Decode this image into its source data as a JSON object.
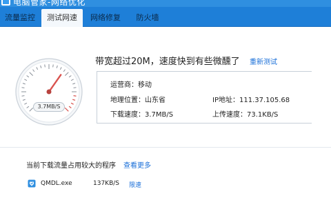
{
  "window": {
    "title": "电脑管家-网络优化"
  },
  "tabs": [
    {
      "label": "流量监控"
    },
    {
      "label": "测试网速",
      "active": true
    },
    {
      "label": "网络修复"
    },
    {
      "label": "防火墙"
    }
  ],
  "speed_test": {
    "headline": "带宽超过20M，速度快到有些微醺了",
    "retest_label": "重新测试",
    "gauge_reading": "3.7MB/S",
    "isp": "运营商：移动",
    "location": "地理位置：山东省",
    "ip": "IP地址：111.37.105.68",
    "download": "下载速度：3.7MB/S",
    "upload": "上传速度：73.1KB/S"
  },
  "programs": {
    "title": "当前下载流量占用较大的程序",
    "more_label": "查看更多",
    "items": [
      {
        "name": "QMDL.exe",
        "rate": "137KB/S",
        "action": "限速"
      }
    ]
  },
  "colors": {
    "titlebar": "#2f8fe0",
    "tabbar": "#1e7fd8",
    "link": "#1a6fd8",
    "needle": "#d9534f"
  }
}
